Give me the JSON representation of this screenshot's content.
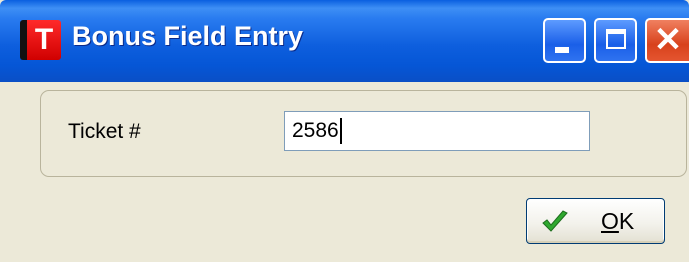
{
  "window": {
    "title": "Bonus Field Entry",
    "app_icon_letter": "T",
    "colors": {
      "titlebar": "#0a5fe0",
      "close": "#d8421c",
      "face": "#ece9d8"
    }
  },
  "form": {
    "ticket_label": "Ticket #",
    "ticket_value": "2586"
  },
  "buttons": {
    "ok_mnemonic": "O",
    "ok_rest": "K",
    "ok_icon": "check-icon"
  }
}
